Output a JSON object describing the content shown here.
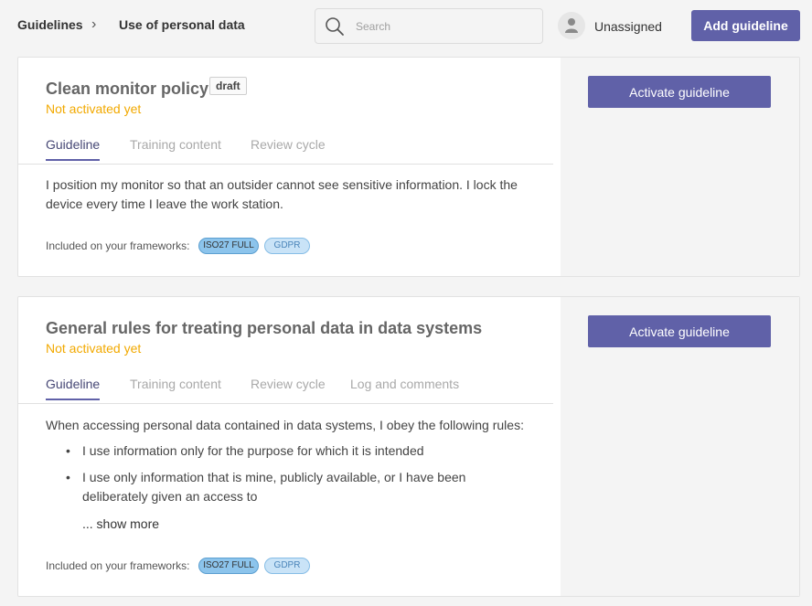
{
  "header": {
    "breadcrumb_root": "Guidelines",
    "breadcrumb_separator": "›",
    "breadcrumb_current": "Use of personal data",
    "search_placeholder": "Search",
    "assignee": "Unassigned",
    "add_button": "Add guideline"
  },
  "cards": [
    {
      "title": "Clean monitor policy",
      "badge": "draft",
      "status": "Not activated yet",
      "tabs": [
        "Guideline",
        "Training content",
        "Review cycle"
      ],
      "active_tab": "Guideline",
      "body": "I position my monitor so that an outsider cannot see sensitive information. I lock the device every time I leave the work station.",
      "frameworks_label": "Included on your frameworks:",
      "frameworks": [
        "ISO27 FULL",
        "GDPR"
      ],
      "action_button": "Activate guideline"
    },
    {
      "title": "General rules for treating personal data in data systems",
      "status": "Not activated yet",
      "tabs": [
        "Guideline",
        "Training content",
        "Review cycle",
        "Log and comments"
      ],
      "active_tab": "Guideline",
      "intro": "When accessing personal data contained in data systems, I obey the following rules:",
      "bullets": [
        "I use information only for the purpose for which it is intended",
        "I use only information that is mine, publicly available, or I have been deliberately given an access to"
      ],
      "show_more": "... show more",
      "frameworks_label": "Included on your frameworks:",
      "frameworks": [
        "ISO27 FULL",
        "GDPR"
      ],
      "action_button": "Activate guideline"
    }
  ],
  "colors": {
    "accent": "#6061a8",
    "status_warning": "#f2a900",
    "active_tab": "#464775"
  },
  "icons": {
    "search": "search-icon",
    "avatar": "person-icon",
    "breadcrumb_sep": "chevron-right-icon"
  }
}
